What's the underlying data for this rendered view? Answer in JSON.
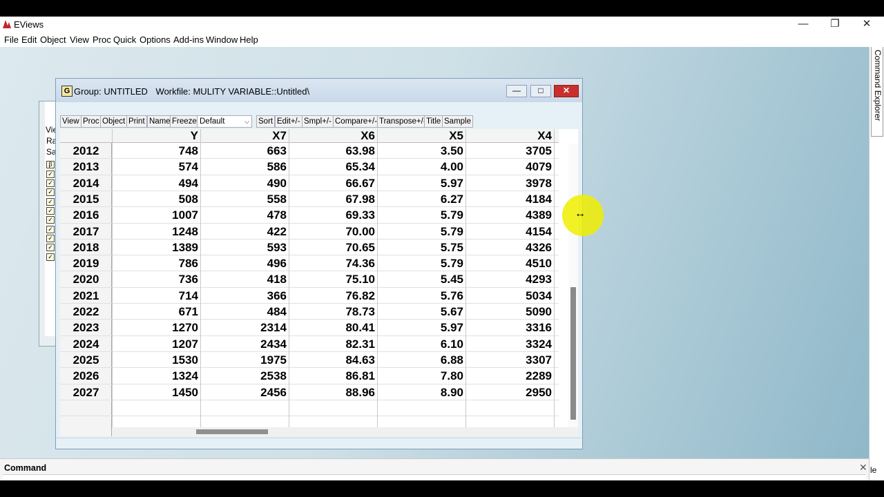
{
  "app": {
    "title": "EViews",
    "window_controls": {
      "minimize": "—",
      "restore": "❐",
      "close": "✕"
    }
  },
  "menu": [
    "File",
    "Edit",
    "Object",
    "View",
    "Proc",
    "Quick",
    "Options",
    "Add-ins",
    "Window",
    "Help"
  ],
  "side_panel": {
    "label": "Command Explorer",
    "bottom_fragment": "le"
  },
  "background_window": {
    "labels": [
      "Vie",
      "Ra",
      "Sa"
    ]
  },
  "group_window": {
    "icon": "G",
    "title": "Group: UNTITLED",
    "workfile": "Workfile: MULITY VARIABLE::Untitled\\",
    "toolbar": {
      "view": "View",
      "proc": "Proc",
      "object": "Object",
      "print": "Print",
      "name": "Name",
      "freeze": "Freeze",
      "sort": "Sort",
      "edit": "Edit+/-",
      "smpl": "Smpl+/-",
      "compare": "Compare+/-",
      "transpose": "Transpose+/-",
      "title": "Title",
      "sample": "Sample"
    },
    "display_select": "Default",
    "columns": [
      "Y",
      "X7",
      "X6",
      "X5",
      "X4"
    ],
    "rows": [
      {
        "year": "2012",
        "values": [
          "748",
          "663",
          "63.98",
          "3.50",
          "3705"
        ]
      },
      {
        "year": "2013",
        "values": [
          "574",
          "586",
          "65.34",
          "4.00",
          "4079"
        ]
      },
      {
        "year": "2014",
        "values": [
          "494",
          "490",
          "66.67",
          "5.97",
          "3978"
        ]
      },
      {
        "year": "2015",
        "values": [
          "508",
          "558",
          "67.98",
          "6.27",
          "4184"
        ]
      },
      {
        "year": "2016",
        "values": [
          "1007",
          "478",
          "69.33",
          "5.79",
          "4389"
        ]
      },
      {
        "year": "2017",
        "values": [
          "1248",
          "422",
          "70.00",
          "5.79",
          "4154"
        ]
      },
      {
        "year": "2018",
        "values": [
          "1389",
          "593",
          "70.65",
          "5.75",
          "4326"
        ]
      },
      {
        "year": "2019",
        "values": [
          "786",
          "496",
          "74.36",
          "5.79",
          "4510"
        ]
      },
      {
        "year": "2020",
        "values": [
          "736",
          "418",
          "75.10",
          "5.45",
          "4293"
        ]
      },
      {
        "year": "2021",
        "values": [
          "714",
          "366",
          "76.82",
          "5.76",
          "5034"
        ]
      },
      {
        "year": "2022",
        "values": [
          "671",
          "484",
          "78.73",
          "5.67",
          "5090"
        ]
      },
      {
        "year": "2023",
        "values": [
          "1270",
          "2314",
          "80.41",
          "5.97",
          "3316"
        ]
      },
      {
        "year": "2024",
        "values": [
          "1207",
          "2434",
          "82.31",
          "6.10",
          "3324"
        ]
      },
      {
        "year": "2025",
        "values": [
          "1530",
          "1975",
          "84.63",
          "6.88",
          "3307"
        ]
      },
      {
        "year": "2026",
        "values": [
          "1324",
          "2538",
          "86.81",
          "7.80",
          "2289"
        ]
      },
      {
        "year": "2027",
        "values": [
          "1450",
          "2456",
          "88.96",
          "8.90",
          "2950"
        ]
      }
    ]
  },
  "command_pane": {
    "label": "Command",
    "close": "✕"
  },
  "colors": {
    "close_button": "#c9302c",
    "cursor_highlight": "#eeee00"
  }
}
